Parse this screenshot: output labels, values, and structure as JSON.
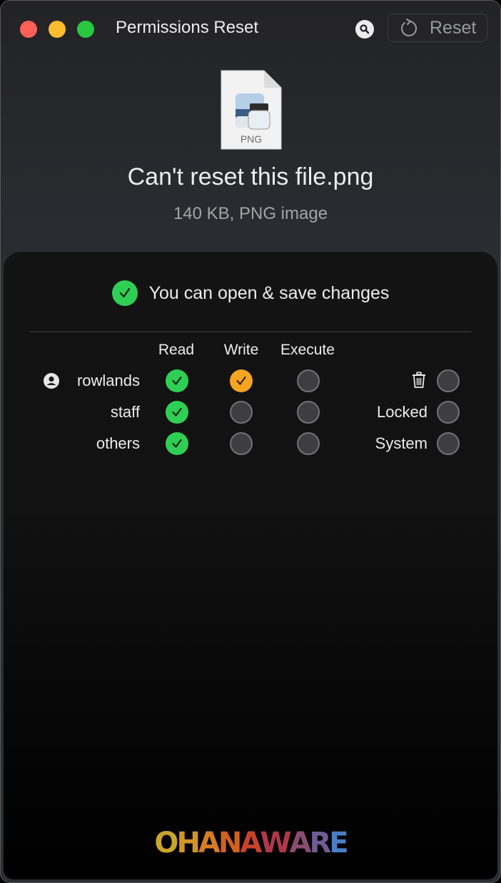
{
  "window": {
    "title": "Permissions Reset",
    "search_icon": "magnifier-icon",
    "reset_button": {
      "label": "Reset",
      "icon": "refresh-icon"
    }
  },
  "file": {
    "icon_label": "PNG",
    "name": "Can't reset this file.png",
    "meta": "140 KB, PNG image"
  },
  "status": {
    "icon": "check-circle-icon",
    "text": "You can open & save changes",
    "color": "#2fcf55"
  },
  "permissions": {
    "columns": [
      "Read",
      "Write",
      "Execute"
    ],
    "rows": [
      {
        "label": "rowlands",
        "icon": "user-icon",
        "read": "on",
        "write": "warning-on",
        "execute": "off"
      },
      {
        "label": "staff",
        "read": "on",
        "write": "off",
        "execute": "off"
      },
      {
        "label": "others",
        "read": "on",
        "write": "off",
        "execute": "off"
      }
    ],
    "flags": [
      {
        "label": "",
        "icon": "trash-icon",
        "value": "off"
      },
      {
        "label": "Locked",
        "value": "off"
      },
      {
        "label": "System",
        "value": "off"
      }
    ],
    "colors": {
      "on": "#2fcf55",
      "warning": "#f4a521",
      "off": "#3e3e40"
    }
  },
  "footer": {
    "logo_letters": [
      "O",
      "H",
      "A",
      "N",
      "A",
      "W",
      "A",
      "R",
      "E"
    ],
    "logo_colors": [
      "#c9a52a",
      "#d39428",
      "#d77d24",
      "#d3611f",
      "#c7442a",
      "#b0384a",
      "#8b4d6f",
      "#6f5d94",
      "#4a7ec6"
    ]
  }
}
